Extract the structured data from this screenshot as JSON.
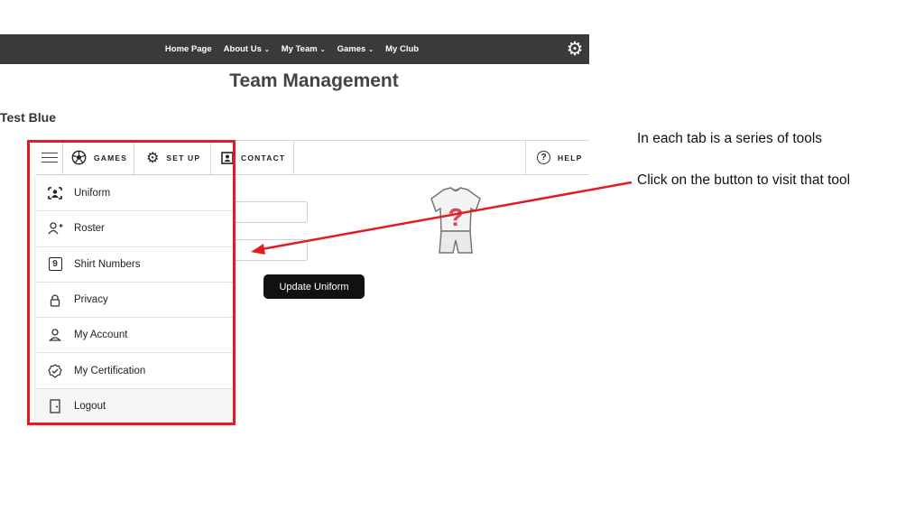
{
  "nav": {
    "links": [
      {
        "label": "Home Page",
        "caret": ""
      },
      {
        "label": "About Us",
        "caret": "⌄"
      },
      {
        "label": "My Team",
        "caret": "⌄"
      },
      {
        "label": "Games",
        "caret": "⌄"
      },
      {
        "label": "My Club",
        "caret": ""
      }
    ],
    "settings_icon": "gear-icon"
  },
  "page": {
    "title": "Team Management",
    "team_name": "Test Blue"
  },
  "tabs": {
    "games": "GAMES",
    "setup": "SET UP",
    "contact": "CONTACT",
    "help": "HELP"
  },
  "menu": {
    "items": [
      {
        "label": "Uniform",
        "icon": "uniform-icon"
      },
      {
        "label": "Roster",
        "icon": "add-person-icon"
      },
      {
        "label": "Shirt Numbers",
        "icon": "number-box-icon",
        "icon_text": "9"
      },
      {
        "label": "Privacy",
        "icon": "lock-icon"
      },
      {
        "label": "My Account",
        "icon": "person-icon"
      },
      {
        "label": "My Certification",
        "icon": "badge-check-icon"
      },
      {
        "label": "Logout",
        "icon": "door-exit-icon"
      }
    ]
  },
  "form": {
    "update_button": "Update Uniform"
  },
  "annotations": {
    "note_1": "In each tab is a series of tools",
    "note_2": "Click on the button to visit that tool"
  },
  "colors": {
    "navbar": "#3a3a3a",
    "highlight": "#e21c23",
    "button": "#111111"
  }
}
